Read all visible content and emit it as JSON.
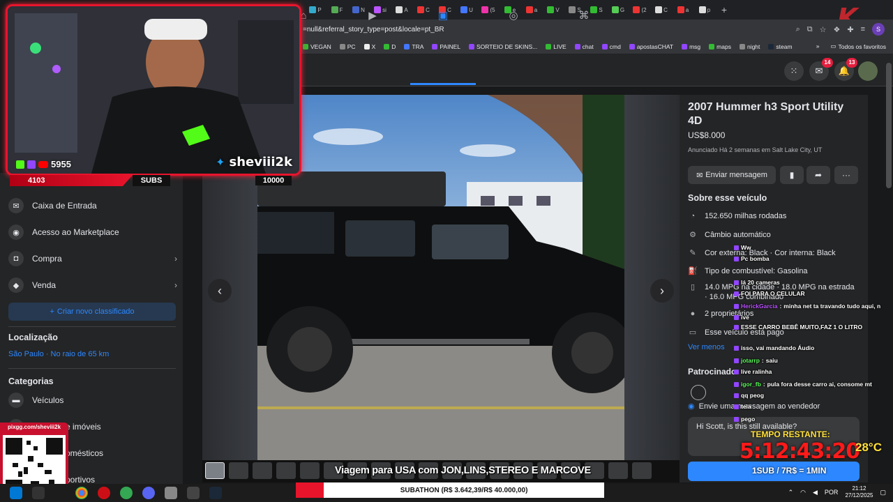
{
  "browser": {
    "url": "=null&referral_story_type=post&locale=pt_BR",
    "bookmarks": [
      "VEGAN",
      "PC",
      "X",
      "D",
      "TRA",
      "PAINEL",
      "SORTEIO DE SKINS...",
      "LIVE",
      "chat",
      "cmd",
      "apostasCHAT",
      "msg",
      "maps",
      "night",
      "steam"
    ],
    "bookmarks_folder": "Todos os favoritos",
    "tab_labels": [
      "P",
      "F",
      "N",
      "si",
      "A",
      "C",
      "C",
      "U",
      "(5",
      "e",
      "a",
      "V",
      "S",
      "S",
      "G",
      "(2",
      "C",
      "a",
      "p"
    ],
    "new_tab": "+",
    "profile_initial": "S"
  },
  "facebook_nav": {
    "messenger_badge": "14",
    "notification_badge": "13"
  },
  "sidebar": {
    "items": [
      {
        "label": "Caixa de Entrada",
        "icon": "inbox-icon"
      },
      {
        "label": "Acesso ao Marketplace",
        "icon": "marketplace-access-icon"
      },
      {
        "label": "Compra",
        "icon": "shopping-bag-icon"
      },
      {
        "label": "Venda",
        "icon": "tag-icon"
      }
    ],
    "create_button": "Criar novo classificado",
    "location_heading": "Localização",
    "location_value": "São Paulo · No raio de 65 km",
    "categories_heading": "Categorias",
    "categories": [
      {
        "label": "Veículos",
        "icon": "car-icon"
      },
      {
        "label": "e imóveis",
        "icon": "house-icon"
      },
      {
        "label": "omésticos",
        "icon": "appliance-icon"
      },
      {
        "label": "portivos",
        "icon": "sports-icon"
      }
    ]
  },
  "listing": {
    "title": "2007 Hummer h3 Sport Utility 4D",
    "price": "US$8.000",
    "listed": "Anunciado Há 2 semanas em Salt Lake City, UT",
    "message_button": "Enviar mensagem",
    "about_heading": "Sobre esse veículo",
    "specs": [
      "152.650 milhas rodadas",
      "Câmbio automático",
      "Cor externa: Black · Cor interna: Black",
      "Tipo de combustível: Gasolina",
      "14.0 MPG na cidade · 18.0 MPG na estrada · 16.0 MPG combinado",
      "2 proprietários",
      "Esse veículo está pago"
    ],
    "see_less": "Ver menos",
    "sponsored_heading": "Patrocinado",
    "send_line": "Envie uma mensagem ao vendedor",
    "message_value": "Hi Scott, is this still available?"
  },
  "stream": {
    "streamer": "sheviii2k",
    "viewers": "5955",
    "counter_left": "4103",
    "counter_label": "SUBS",
    "counter_goal": "10000",
    "chat": [
      {
        "user": "",
        "text": "Ww"
      },
      {
        "user": "",
        "text": "Pc bomba"
      },
      {
        "user": "",
        "text": "lá 20 cameras"
      },
      {
        "user": "",
        "text": "FOI PARA O CELULAR"
      },
      {
        "user": "HerickGarcia",
        "text": "minha net ta travando tudo aqui, n"
      },
      {
        "user": "",
        "text": "ive"
      },
      {
        "user": "",
        "text": "ESSE CARRO BEBÊ MUITO,FAZ 1 O LITRO"
      },
      {
        "user": "",
        "text": "isso, vai mandando Áudio"
      },
      {
        "user": "jotarrp",
        "text": "saiu"
      },
      {
        "user": "",
        "text": "live ralinha"
      },
      {
        "user": "igor_fb",
        "text": "pula fora desse carro ai, consome mt"
      },
      {
        "user": "",
        "text": "qq peog"
      },
      {
        "user": "",
        "text": "tela"
      },
      {
        "user": "",
        "text": "pego"
      }
    ],
    "timer_label": "TEMPO RESTANTE:",
    "timer": "5:12:43:20",
    "temperature": "28°C",
    "sub_rate": "1SUB / 7R$ = 1MIN",
    "qr_url": "pixgg.com/sheviii2k",
    "caption": "Viagem para USA com JON,LINS,STEREO E MARCOVE",
    "subathon": "SUBATHON (R$ 3.642,39/R$ 40.000,00)",
    "subathon_progress": 0.091
  },
  "taskbar": {
    "language": "POR",
    "time": "21:12",
    "date": "27/12/2025"
  }
}
